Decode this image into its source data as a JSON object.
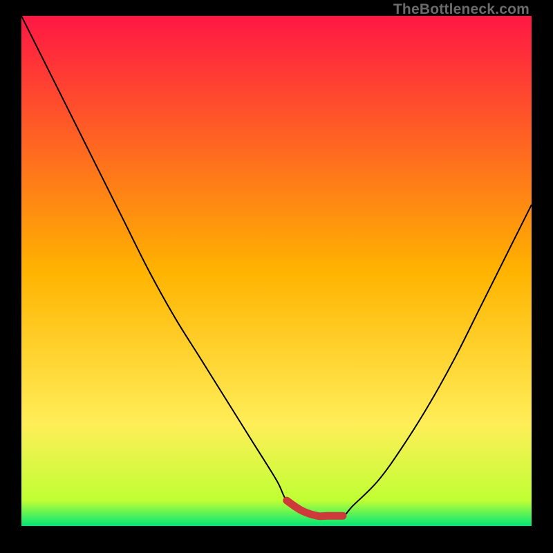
{
  "watermark": "TheBottleneck.com",
  "chart_data": {
    "type": "line",
    "title": "",
    "xlabel": "",
    "ylabel": "",
    "xlim": [
      0,
      100
    ],
    "ylim": [
      0,
      100
    ],
    "gradient_stops": [
      {
        "offset": 0,
        "color": "#ff1744"
      },
      {
        "offset": 50,
        "color": "#ffb300"
      },
      {
        "offset": 80,
        "color": "#ffee58"
      },
      {
        "offset": 95,
        "color": "#c0ff33"
      },
      {
        "offset": 100,
        "color": "#00e676"
      }
    ],
    "series": [
      {
        "name": "curve",
        "x": [
          0,
          5,
          10,
          15,
          20,
          25,
          30,
          35,
          40,
          45,
          50,
          52,
          55,
          58,
          60,
          63,
          65,
          70,
          75,
          80,
          85,
          90,
          95,
          100
        ],
        "y": [
          100,
          90,
          80,
          70,
          60,
          50,
          41,
          33,
          25,
          17,
          9,
          5,
          3,
          2,
          2,
          2,
          4,
          9,
          16,
          24,
          33,
          43,
          53,
          63
        ]
      },
      {
        "name": "highlight",
        "x": [
          52,
          55,
          58,
          60,
          63
        ],
        "y": [
          5,
          3,
          2,
          2,
          2
        ]
      }
    ],
    "colors": {
      "curve": "#000000",
      "highlight": "#ce3a3a"
    }
  }
}
